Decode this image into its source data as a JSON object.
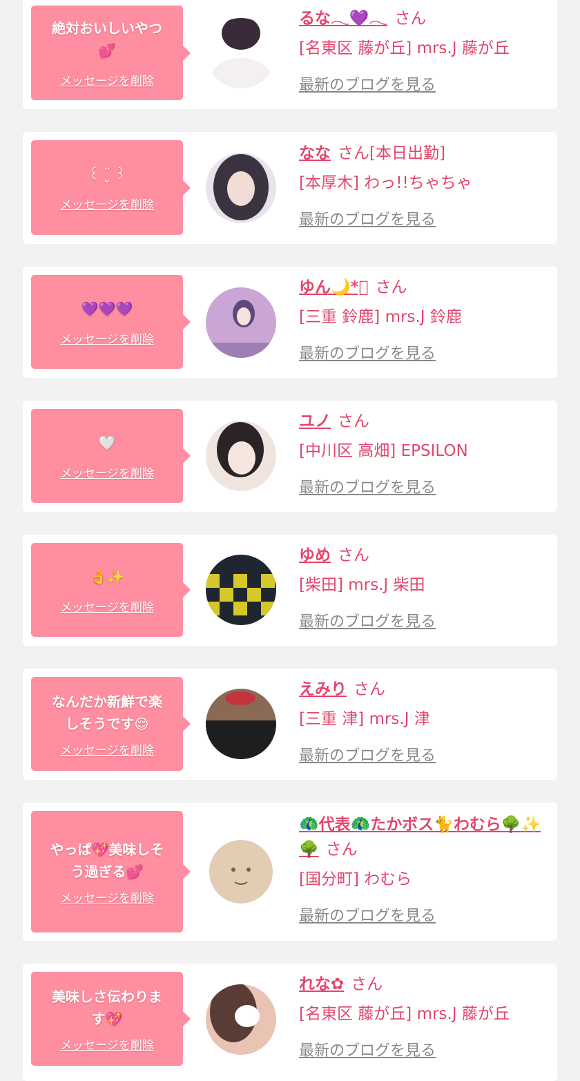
{
  "cards": [
    {
      "message": "絶対おいしいやつ\n💕",
      "delete_label": "メッセージを削除",
      "name": "るな𓂃💜𓂃",
      "suffix": "さん",
      "shop": "[名東区 藤が丘] mrs.J 藤が丘",
      "blog_label": "最新のブログを見る",
      "avatar_colors": [
        "#ffffff",
        "#3a2a3a"
      ]
    },
    {
      "message": "꒰ ¨̮ ꒱",
      "delete_label": "メッセージを削除",
      "name": "なな",
      "suffix": "さん[本日出勤]",
      "shop": "[本厚木] わっ!!ちゃちゃ",
      "blog_label": "最新のブログを見る",
      "avatar_colors": [
        "#e8e4ec",
        "#3b3340"
      ]
    },
    {
      "message": "💜💜💜",
      "delete_label": "メッセージを削除",
      "name": "ゆん🌙*ﾟ",
      "suffix": "さん",
      "shop": "[三重 鈴鹿] mrs.J 鈴鹿",
      "blog_label": "最新のブログを見る",
      "avatar_colors": [
        "#c9a6d6",
        "#5b4a7a"
      ]
    },
    {
      "message": "🤍",
      "delete_label": "メッセージを削除",
      "name": "ユノ",
      "suffix": "さん",
      "shop": "[中川区 高畑] EPSILON",
      "blog_label": "最新のブログを見る",
      "avatar_colors": [
        "#f0e4df",
        "#2a2426"
      ]
    },
    {
      "message": "👌✨",
      "delete_label": "メッセージを削除",
      "name": "ゆめ",
      "suffix": "さん",
      "shop": "[柴田] mrs.J 柴田",
      "blog_label": "最新のブログを見る",
      "avatar_colors": [
        "#d6c82a",
        "#1f2630"
      ]
    },
    {
      "message": "なんだか新鮮で楽\nしそうです😌",
      "delete_label": "メッセージを削除",
      "name": "えみり",
      "suffix": "さん",
      "shop": "[三重 津] mrs.J 津",
      "blog_label": "最新のブログを見る",
      "avatar_colors": [
        "#8a6a54",
        "#1e1e20"
      ]
    },
    {
      "message": "やっぱ💖美味しそ\nう過ぎる💕",
      "delete_label": "メッセージを削除",
      "name": "🦚代表🦚たかボス🐈わむら🌳✨🌳",
      "suffix": "さん",
      "shop": "[国分町] わむら",
      "blog_label": "最新のブログを見る",
      "avatar_colors": [
        "#e2cdb4",
        "#7b5e46"
      ]
    },
    {
      "message": "美味しさ伝わりま\nす💖",
      "delete_label": "メッセージを削除",
      "name": "れな✿",
      "suffix": "さん",
      "shop": "[名東区 藤が丘] mrs.J 藤が丘",
      "blog_label": "最新のブログを見る",
      "avatar_colors": [
        "#e9c3b4",
        "#5a3c36"
      ]
    }
  ]
}
